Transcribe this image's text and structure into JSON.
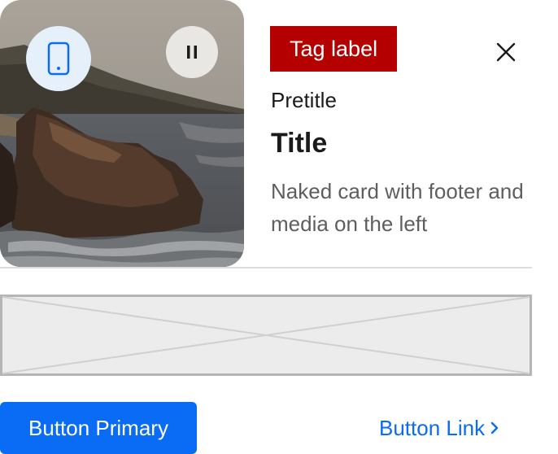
{
  "card": {
    "tag_label": "Tag label",
    "pretitle": "Pretitle",
    "title": "Title",
    "description": "Naked card with footer and media on the left"
  },
  "media": {
    "device_icon": "mobile-phone-icon",
    "pause_icon": "pause-icon",
    "close_icon": "close-icon"
  },
  "footer": {
    "primary_button_label": "Button Primary",
    "link_button_label": "Button Link"
  },
  "colors": {
    "tag_background": "#b40000",
    "primary": "#0a6cf5",
    "device_button_bg": "#e6f0fb",
    "pause_button_bg": "#e9e7e4",
    "description_text": "#5e5e5e"
  }
}
